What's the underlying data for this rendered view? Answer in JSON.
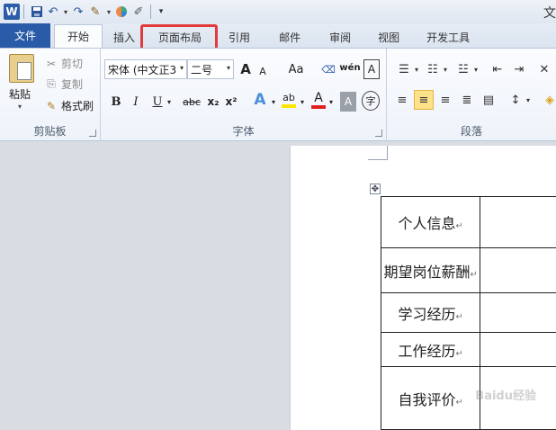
{
  "app": {
    "title_char": "文"
  },
  "qat": {
    "logo": "W",
    "more": "▾"
  },
  "tabs": [
    {
      "label": "文件"
    },
    {
      "label": "开始"
    },
    {
      "label": "插入"
    },
    {
      "label": "页面布局"
    },
    {
      "label": "引用"
    },
    {
      "label": "邮件"
    },
    {
      "label": "审阅"
    },
    {
      "label": "视图"
    },
    {
      "label": "开发工具"
    }
  ],
  "clipboard": {
    "paste": "粘贴",
    "cut": "剪切",
    "copy": "复制",
    "format_painter": "格式刷",
    "group": "剪贴板"
  },
  "font": {
    "name": "宋体 (中文正3",
    "size": "二号",
    "grow": "A",
    "shrink": "A",
    "case": "Aa",
    "phonetic": "wén",
    "bold": "B",
    "italic": "I",
    "underline": "U",
    "strike": "abc",
    "sub": "x₂",
    "sup": "x²",
    "group": "字体",
    "accent_color": "#e02020",
    "highlight_color": "#ffe600"
  },
  "paragraph": {
    "group": "段落"
  },
  "document": {
    "rows": [
      {
        "label": "个人信息",
        "mark": "↵"
      },
      {
        "label": "期望岗位薪酬",
        "mark": "↵"
      },
      {
        "label": "学习经历",
        "mark": "↵"
      },
      {
        "label": "工作经历",
        "mark": "↵"
      },
      {
        "label": "自我评价",
        "mark": "↵"
      }
    ],
    "watermark": "Baidu经验"
  }
}
